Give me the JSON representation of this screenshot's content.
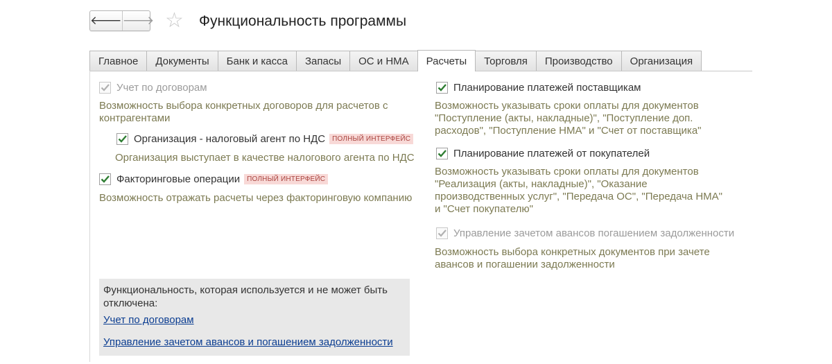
{
  "header": {
    "back_glyph": "🡐",
    "forward_glyph": "🡒",
    "star_glyph": "☆",
    "title": "Функциональность программы"
  },
  "tabs": [
    {
      "label": "Главное",
      "active": false
    },
    {
      "label": "Документы",
      "active": false
    },
    {
      "label": "Банк и касса",
      "active": false
    },
    {
      "label": "Запасы",
      "active": false
    },
    {
      "label": "ОС и НМА",
      "active": false
    },
    {
      "label": "Расчеты",
      "active": true
    },
    {
      "label": "Торговля",
      "active": false
    },
    {
      "label": "Производство",
      "active": false
    },
    {
      "label": "Организация",
      "active": false
    }
  ],
  "left": {
    "contracts": {
      "label": "Учет по договорам",
      "checked": true,
      "disabled": true,
      "desc_line1": "Возможность выбора конкретных договоров для расчетов с",
      "desc_line2": "контрагентами"
    },
    "vat_agent": {
      "label": "Организация - налоговый агент по НДС",
      "badge": "ПОЛНЫЙ ИНТЕРФЕЙС",
      "checked": true,
      "desc": "Организация выступает в качестве налогового агента по НДС"
    },
    "factoring": {
      "label": "Факторинговые операции",
      "badge": "ПОЛНЫЙ ИНТЕРФЕЙС",
      "checked": true,
      "desc": "Возможность отражать расчеты через факторинговую компанию"
    }
  },
  "right": {
    "supplier_payments": {
      "label": "Планирование платежей поставщикам",
      "checked": true,
      "desc_line1": "Возможность указывать сроки оплаты для документов",
      "desc_line2": "\"Поступление (акты, накладные)\", \"Поступление доп.",
      "desc_line3": "расходов\", \"Поступление НМА\" и \"Счет от поставщика\""
    },
    "customer_payments": {
      "label": "Планирование платежей от покупателей",
      "checked": true,
      "desc_line1": "Возможность указывать сроки оплаты для документов",
      "desc_line2": "\"Реализация (акты, накладные)\", \"Оказание",
      "desc_line3": "производственных услуг\", \"Передача ОС\", \"Передача НМА\"",
      "desc_line4": "и \"Счет покупателю\""
    },
    "advances": {
      "label": "Управление зачетом авансов погашением задолженности",
      "checked": true,
      "disabled": true,
      "desc_line1": "Возможность выбора конкретных документов при зачете",
      "desc_line2": "авансов и погашении задолженности"
    }
  },
  "info_box": {
    "text_line1": "Функциональность, которая используется и не может быть",
    "text_line2": "отключена:",
    "link1": "Учет по договорам",
    "link2": "Управление зачетом авансов и погашением задолженности"
  },
  "colors": {
    "check_active": "#2e7d32",
    "check_disabled": "#b0b0b0",
    "description": "#7c7a52",
    "badge_text": "#a9443f",
    "badge_bg": "#f8d9d7",
    "link": "#0b3d91"
  }
}
